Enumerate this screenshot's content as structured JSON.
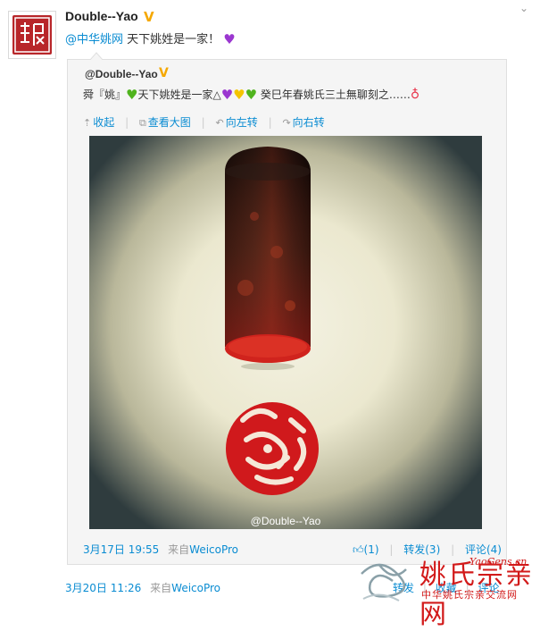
{
  "post": {
    "author": "Double--Yao",
    "verified_badge": "V",
    "close_symbol": "⌄",
    "mention": "@中华姚网",
    "text": " 天下姚姓是一家！",
    "emoji": "purple-heart"
  },
  "repost": {
    "author": "@Double--Yao",
    "verified_badge": "V",
    "text_part1": "舜『姚』",
    "text_part2": "天下姚姓是一家△",
    "text_part3": " 癸巳年春姚氏三土無聊刻之……",
    "toolbar": {
      "collapse": "收起",
      "view_large": "查看大图",
      "rotate_left": "向左转",
      "rotate_right": "向右转"
    },
    "image_watermark": "@Double--Yao",
    "time": "3月17日 19:55",
    "source_prefix": "来自",
    "source": "WeicoPro",
    "actions": {
      "like": "(1)",
      "forward": "转发(3)",
      "comment": "评论(4)"
    }
  },
  "meta": {
    "time": "3月20日 11:26",
    "source_prefix": "来自",
    "source": "WeicoPro",
    "forward": "转发",
    "favorite": "收藏",
    "comment": "评论"
  },
  "watermark_logo": {
    "name": "姚氏宗亲网",
    "url": "YaoGens.cn",
    "subtitle": "中华姚氏宗亲交流网"
  },
  "colors": {
    "link": "#0a8cd2",
    "seal_red": "#b8262a",
    "badge_gold": "#f5a800"
  }
}
